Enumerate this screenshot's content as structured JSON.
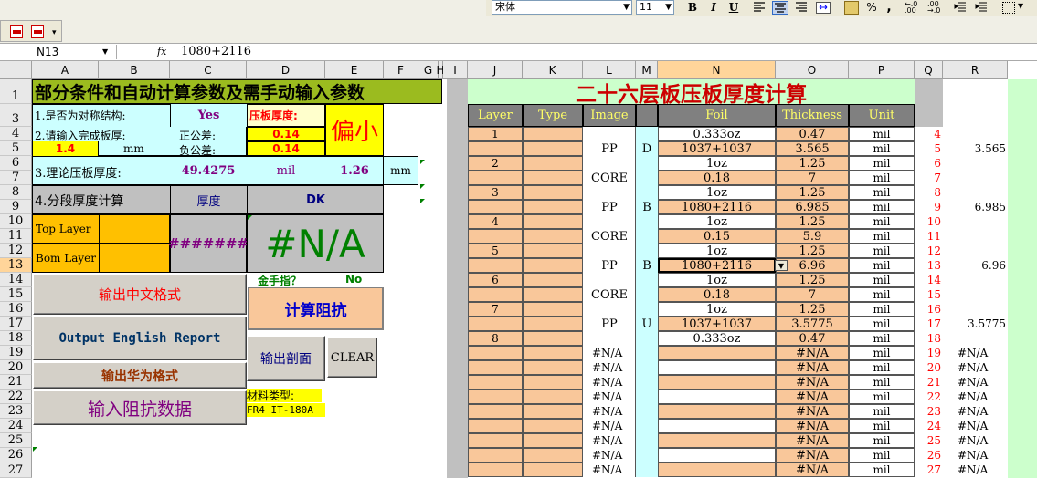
{
  "toolbar": {
    "font_name": "宋体",
    "font_size": "11",
    "bold": "B",
    "italic": "I",
    "underline": "U",
    "percent": "%",
    "comma": ","
  },
  "formula_bar": {
    "name_box": "N13",
    "fx": "fx",
    "value": "1080+2116"
  },
  "col_headers": [
    "A",
    "B",
    "C",
    "D",
    "E",
    "F",
    "G",
    "H",
    "I",
    "J",
    "K",
    "L",
    "M",
    "N",
    "O",
    "P",
    "Q",
    "R"
  ],
  "row_numbers": [
    "1",
    "3",
    "4",
    "5",
    "6",
    "7",
    "8",
    "9",
    "10",
    "11",
    "12",
    "13",
    "14",
    "15",
    "16",
    "17",
    "18",
    "19",
    "20",
    "21",
    "22",
    "23",
    "24",
    "25",
    "26",
    "27"
  ],
  "left": {
    "title": "部分条件和自动计算参数及需手动输入参数",
    "q1_label": "1.是否为对称结构:",
    "q1_value": "Yes",
    "thick_label": "压板厚度:",
    "result_word": "偏小",
    "q2_label": "2.请输入完成板厚:",
    "pos_tol_label": "正公差:",
    "pos_tol": "0.14",
    "finish_thick": "1.4",
    "mm": "mm",
    "neg_tol_label": "负公差:",
    "neg_tol": "0.14",
    "q3_label": "3.理论压板厚度:",
    "theory_value": "49.4275",
    "mil": "mil",
    "theory_mm": "1.26",
    "mm2": "mm",
    "q4_label": "4.分段厚度计算",
    "col_thick": "厚度",
    "col_dk": "DK",
    "top_layer": "Top Layer",
    "bom_layer": "Bom Layer",
    "hashes": "#######",
    "na_big": "#N/A",
    "gold_finger": "金手指？",
    "gold_value": "No",
    "material_label": "材料类型:",
    "material_value": "FR4 IT-180A"
  },
  "buttons": {
    "cn_format": "输出中文格式",
    "calc_impedance": "计算阻抗",
    "english_report": "Output English Report",
    "section": "输出剖面",
    "clear": "CLEAR",
    "huawei_format": "输出华为格式",
    "input_impedance": "输入阻抗数据"
  },
  "right": {
    "title": "二十六层板压板厚度计算",
    "headers": {
      "layer": "Layer",
      "type": "Type",
      "image": "Image",
      "foil": "Foil",
      "thickness": "Thickness",
      "unit": "Unit"
    },
    "layer_labels": [
      "1",
      "2",
      "3",
      "4",
      "5",
      "6",
      "7",
      "8"
    ],
    "rows": [
      {
        "q": "4",
        "foil": "0.333oz",
        "thk": "0.47",
        "unit": "mil",
        "r": ""
      },
      {
        "q": "5",
        "foil": "1037+1037",
        "thk": "3.565",
        "unit": "mil",
        "r": "3.565"
      },
      {
        "q": "6",
        "foil": "1oz",
        "thk": "1.25",
        "unit": "mil",
        "r": ""
      },
      {
        "q": "7",
        "foil": "0.18",
        "thk": "7",
        "unit": "mil",
        "r": ""
      },
      {
        "q": "8",
        "foil": "1oz",
        "thk": "1.25",
        "unit": "mil",
        "r": ""
      },
      {
        "q": "9",
        "foil": "1080+2116",
        "thk": "6.985",
        "unit": "mil",
        "r": "6.985"
      },
      {
        "q": "10",
        "foil": "1oz",
        "thk": "1.25",
        "unit": "mil",
        "r": ""
      },
      {
        "q": "11",
        "foil": "0.15",
        "thk": "5.9",
        "unit": "mil",
        "r": ""
      },
      {
        "q": "12",
        "foil": "1oz",
        "thk": "1.25",
        "unit": "mil",
        "r": ""
      },
      {
        "q": "13",
        "foil": "1080+2116",
        "thk": "6.96",
        "unit": "mil",
        "r": "6.96"
      },
      {
        "q": "14",
        "foil": "1oz",
        "thk": "1.25",
        "unit": "mil",
        "r": ""
      },
      {
        "q": "15",
        "foil": "0.18",
        "thk": "7",
        "unit": "mil",
        "r": ""
      },
      {
        "q": "16",
        "foil": "1oz",
        "thk": "1.25",
        "unit": "mil",
        "r": ""
      },
      {
        "q": "17",
        "foil": "1037+1037",
        "thk": "3.5775",
        "unit": "mil",
        "r": "3.5775"
      },
      {
        "q": "18",
        "foil": "0.333oz",
        "thk": "0.47",
        "unit": "mil",
        "r": ""
      },
      {
        "q": "19",
        "foil": "",
        "thk": "#N/A",
        "unit": "mil",
        "r": "#N/A"
      },
      {
        "q": "20",
        "foil": "",
        "thk": "#N/A",
        "unit": "mil",
        "r": "#N/A"
      },
      {
        "q": "21",
        "foil": "",
        "thk": "#N/A",
        "unit": "mil",
        "r": "#N/A"
      },
      {
        "q": "22",
        "foil": "",
        "thk": "#N/A",
        "unit": "mil",
        "r": "#N/A"
      },
      {
        "q": "23",
        "foil": "",
        "thk": "#N/A",
        "unit": "mil",
        "r": "#N/A"
      },
      {
        "q": "24",
        "foil": "",
        "thk": "#N/A",
        "unit": "mil",
        "r": "#N/A"
      },
      {
        "q": "25",
        "foil": "",
        "thk": "#N/A",
        "unit": "mil",
        "r": "#N/A"
      },
      {
        "q": "26",
        "foil": "",
        "thk": "#N/A",
        "unit": "mil",
        "r": "#N/A"
      },
      {
        "q": "27",
        "foil": "",
        "thk": "#N/A",
        "unit": "mil",
        "r": "#N/A"
      }
    ],
    "image_labels": [
      "PP",
      "CORE",
      "PP",
      "CORE",
      "PP",
      "CORE",
      "PP"
    ],
    "m_labels": [
      "D",
      "B",
      "B",
      "U"
    ],
    "image_na": [
      "#N/A",
      "#N/A",
      "#N/A",
      "#N/A",
      "#N/A",
      "#N/A",
      "#N/A",
      "#N/A",
      "#N/A"
    ]
  },
  "colors": {
    "olive": "#9bbb1f",
    "peach": "#f9c79a",
    "header_grey": "#808080",
    "yellow": "#ffff00",
    "light_yellow": "#ffffcc",
    "cyan": "#ccffff",
    "orange": "#ffc000",
    "mint": "#ccffcc",
    "red_text": "#ff0000"
  }
}
